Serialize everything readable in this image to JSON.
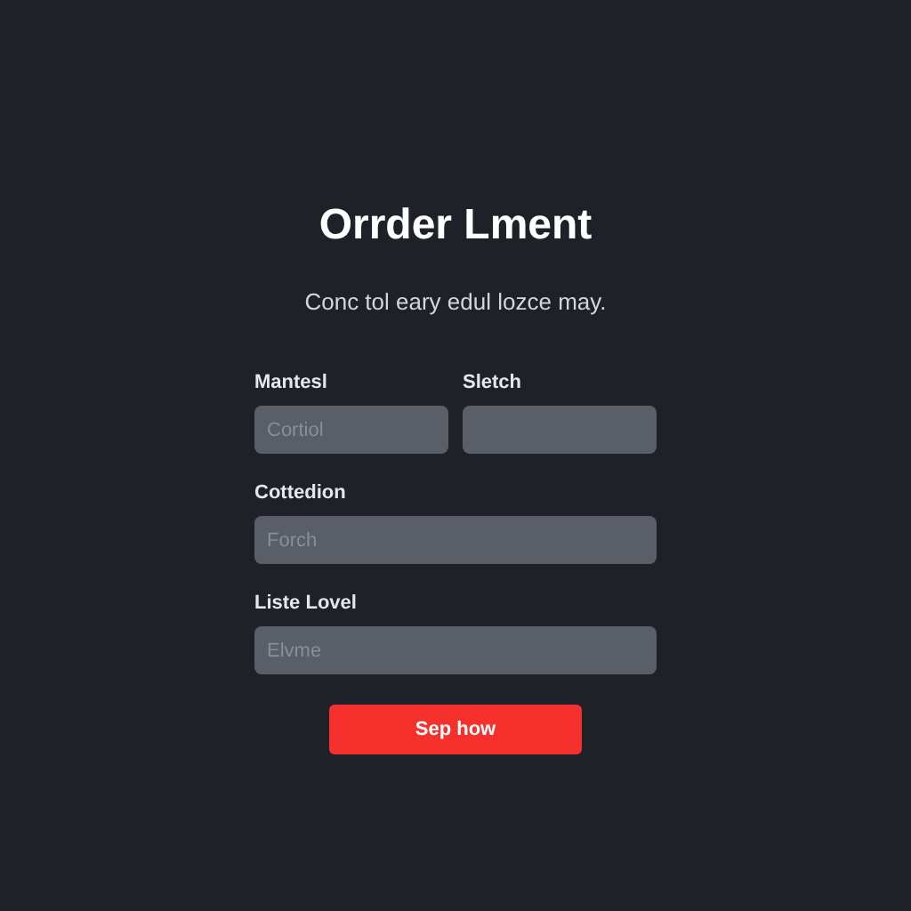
{
  "title": "Orrder Lment",
  "subtitle": "Conc tol eary edul lozce may.",
  "rows": [
    {
      "fields": [
        {
          "label": "Mantesl",
          "placeholder": "Cortiol"
        },
        {
          "label": "Sletch"
        }
      ]
    },
    {
      "fields": [
        {
          "label": "Cottedion",
          "placeholder": "Forch"
        }
      ]
    },
    {
      "fields": [
        {
          "label": "Liste Lovel",
          "placeholder": "Elvme"
        }
      ]
    }
  ],
  "button": "Sep how"
}
